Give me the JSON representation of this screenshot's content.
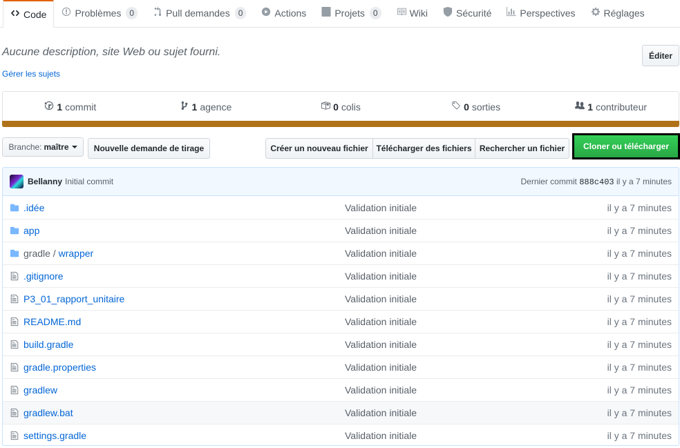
{
  "tabs": [
    {
      "label": "Code",
      "icon": "code-icon",
      "selected": true
    },
    {
      "label": "Problèmes",
      "icon": "issue-icon",
      "count": "0"
    },
    {
      "label": "Pull demandes",
      "icon": "pull-request-icon",
      "count": "0"
    },
    {
      "label": "Actions",
      "icon": "play-icon"
    },
    {
      "label": "Projets",
      "icon": "project-icon",
      "count": "0"
    },
    {
      "label": "Wiki",
      "icon": "book-icon"
    },
    {
      "label": "Sécurité",
      "icon": "shield-icon"
    },
    {
      "label": "Perspectives",
      "icon": "graph-icon"
    },
    {
      "label": "Réglages",
      "icon": "gear-icon"
    }
  ],
  "repo": {
    "description": "Aucune description, site Web ou sujet fourni.",
    "topics_link": "Gérer les sujets",
    "edit_label": "Éditer"
  },
  "summary": {
    "commits": {
      "count": "1",
      "label": "commit"
    },
    "branches": {
      "count": "1",
      "label": "agence"
    },
    "packages": {
      "count": "0",
      "label": "colis"
    },
    "releases": {
      "count": "0",
      "label": "sorties"
    },
    "contributors": {
      "count": "1",
      "label": "contributeur"
    },
    "language_color": "#b07219"
  },
  "toolbar": {
    "branch_prefix": "Branche:",
    "branch_name": "maître",
    "new_pr": "Nouvelle demande de tirage",
    "create_file": "Créer un nouveau fichier",
    "upload_files": "Télécharger des fichiers",
    "find_file": "Rechercher un fichier",
    "clone": "Cloner ou télécharger"
  },
  "commit": {
    "author": "Bellanny",
    "message": "Initial commit",
    "last_label": "Dernier commit",
    "sha": "888c403",
    "age": "il y a 7 minutes"
  },
  "files": [
    {
      "type": "dir",
      "name": ".idée",
      "message": "Validation initiale",
      "age": "il y a 7 minutes"
    },
    {
      "type": "dir",
      "name": "app",
      "message": "Validation initiale",
      "age": "il y a 7 minutes"
    },
    {
      "type": "dir",
      "name_prefix": "gradle / ",
      "name": "wrapper",
      "message": "Validation initiale",
      "age": "il y a 7 minutes"
    },
    {
      "type": "file",
      "name": ".gitignore",
      "message": "Validation initiale",
      "age": "il y a 7 minutes"
    },
    {
      "type": "file",
      "name": "P3_01_rapport_unitaire",
      "message": "Validation initiale",
      "age": "il y a 7 minutes"
    },
    {
      "type": "file",
      "name": "README.md",
      "message": "Validation initiale",
      "age": "il y a 7 minutes"
    },
    {
      "type": "file",
      "name": "build.gradle",
      "message": "Validation initiale",
      "age": "il y a 7 minutes"
    },
    {
      "type": "file",
      "name": "gradle.properties",
      "message": "Validation initiale",
      "age": "il y a 7 minutes"
    },
    {
      "type": "file",
      "name": "gradlew",
      "message": "Validation initiale",
      "age": "il y a 7 minutes"
    },
    {
      "type": "file",
      "name": "gradlew.bat",
      "message": "Validation initiale",
      "age": "il y a 7 minutes",
      "highlighted": true
    },
    {
      "type": "file",
      "name": "settings.gradle",
      "message": "Validation initiale",
      "age": "il y a 7 minutes"
    }
  ]
}
